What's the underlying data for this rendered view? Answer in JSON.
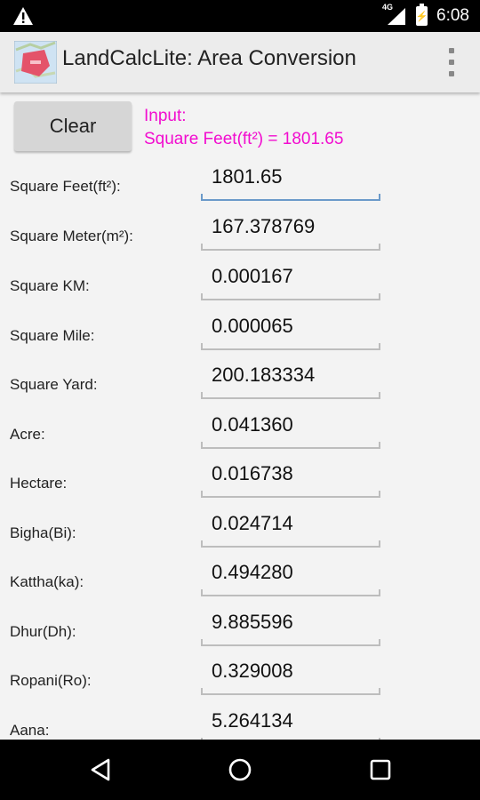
{
  "status_bar": {
    "time": "6:08",
    "network": "4G",
    "battery_icon": "battery-charging-icon",
    "warning_icon": "warning-icon"
  },
  "app_bar": {
    "title": "LandCalcLite: Area Conversion",
    "icon": "app-map-icon",
    "menu_icon": "overflow-menu-icon"
  },
  "controls": {
    "clear_label": "Clear",
    "input_heading": "Input:",
    "input_summary": "Square Feet(ft²) = 1801.65"
  },
  "conversions": [
    {
      "label": "Square Feet(ft²):",
      "value": "1801.65"
    },
    {
      "label": "Square Meter(m²):",
      "value": "167.378769"
    },
    {
      "label": "Square KM:",
      "value": "0.000167"
    },
    {
      "label": "Square Mile:",
      "value": "0.000065"
    },
    {
      "label": "Square Yard:",
      "value": "200.183334"
    },
    {
      "label": "Acre:",
      "value": "0.041360"
    },
    {
      "label": "Hectare:",
      "value": "0.016738"
    },
    {
      "label": "Bigha(Bi):",
      "value": "0.024714"
    },
    {
      "label": "Kattha(ka):",
      "value": "0.494280"
    },
    {
      "label": "Dhur(Dh):",
      "value": "9.885596"
    },
    {
      "label": "Ropani(Ro):",
      "value": "0.329008"
    },
    {
      "label": "Aana:",
      "value": "5.264134"
    }
  ],
  "colors": {
    "accent_magenta": "#f20ccf",
    "focus_blue": "#6b9ac9",
    "background": "#f3f3f3"
  },
  "nav_bar": {
    "back_icon": "back-triangle-icon",
    "home_icon": "home-circle-icon",
    "recents_icon": "recents-square-icon"
  }
}
